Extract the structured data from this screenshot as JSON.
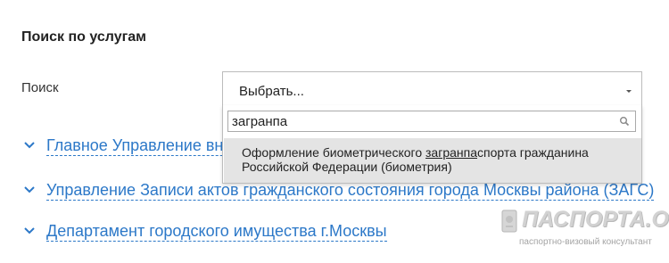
{
  "section": {
    "title": "Поиск по услугам"
  },
  "search": {
    "label": "Поиск",
    "select_value": "Выбрать...",
    "query": "загранпа"
  },
  "dropdown": {
    "option": {
      "before": "Оформление биометрического ",
      "match": "загранпа",
      "after": "спорта гражданина",
      "line2": "Российской Федерации (биометрия)"
    }
  },
  "departments": [
    {
      "label": "Главное Управление внутренних дел Российской Федерации по городу Москве"
    },
    {
      "label": "Управление Записи актов гражданского состояния города Москвы района (ЗАГС)"
    },
    {
      "label": "Департамент городского имущества г.Москвы"
    }
  ],
  "watermark": {
    "title": "ПАСПОРТА.ORG",
    "subtitle": "паспортно-визовый консультант"
  },
  "colors": {
    "link": "#2c78c8",
    "highlight": "#e4e4e4"
  }
}
